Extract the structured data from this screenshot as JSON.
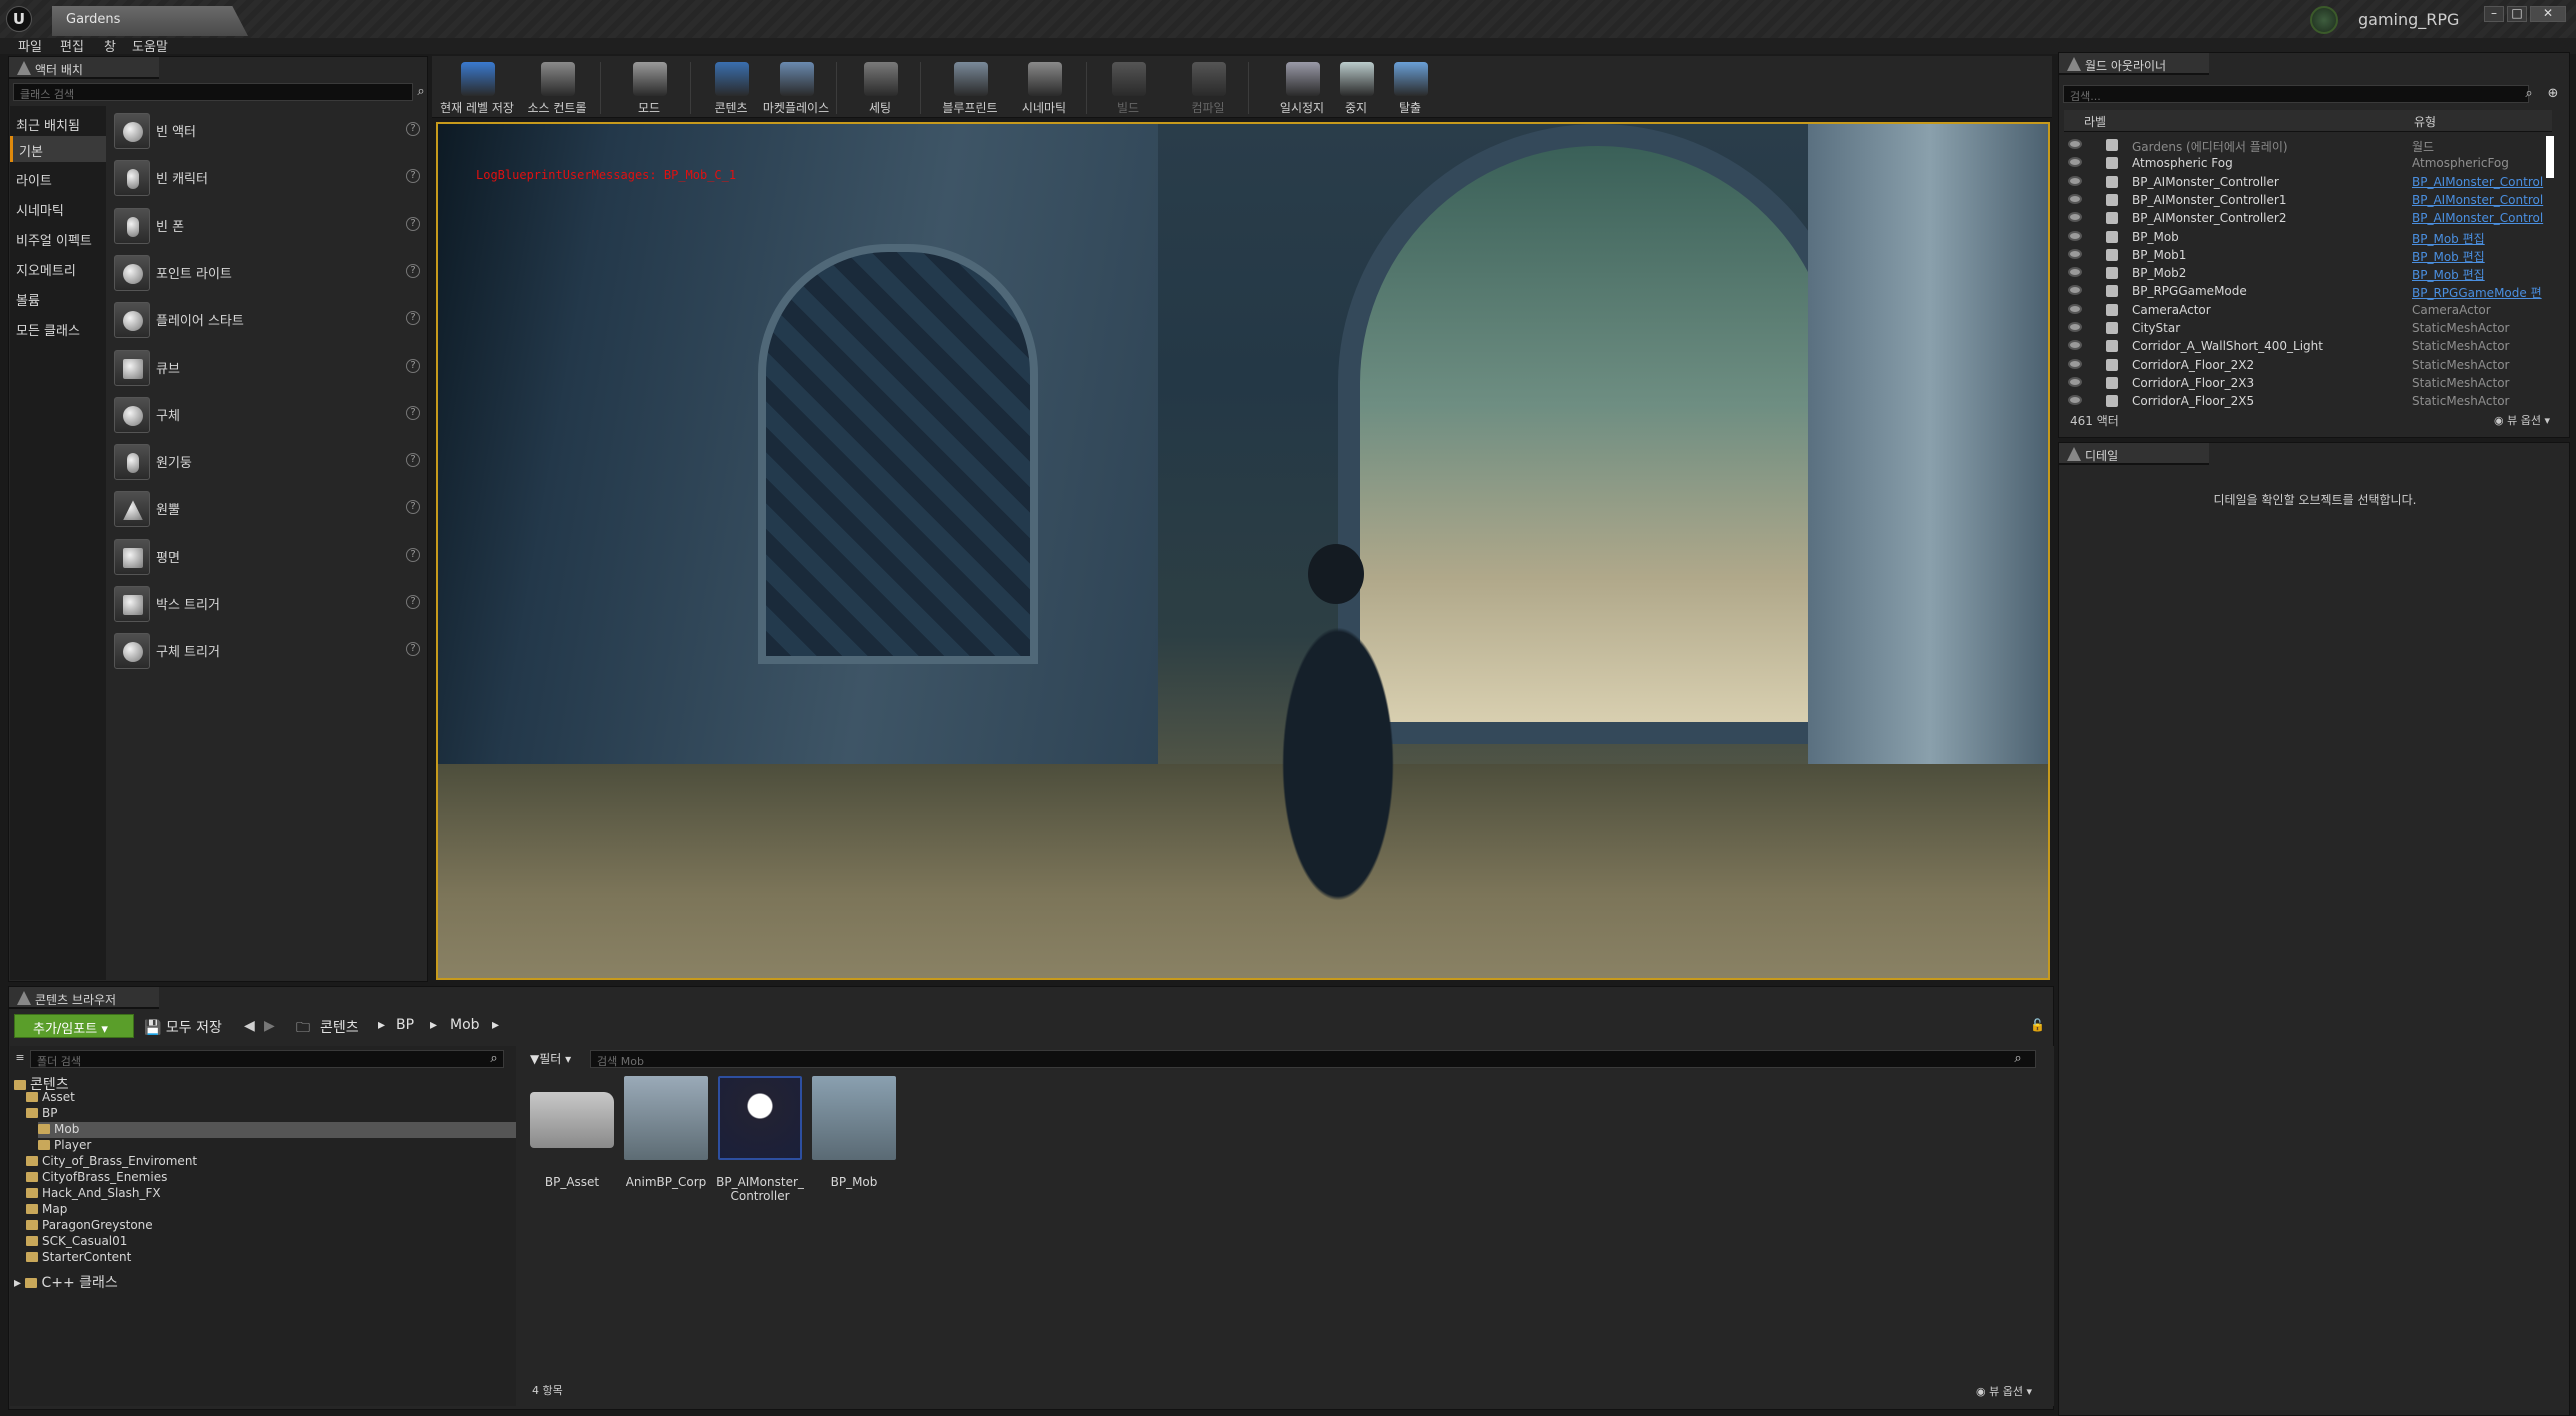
{
  "titlebar": {
    "doc_tab": "Gardens",
    "project_name": "gaming_RPG"
  },
  "menubar": [
    "파일",
    "편집",
    "창",
    "도움말"
  ],
  "place_actors": {
    "tab": "액터 배치",
    "search_placeholder": "클래스 검색",
    "categories": [
      "최근 배치됨",
      "기본",
      "라이트",
      "시네마틱",
      "비주얼 이펙트",
      "지오메트리",
      "볼륨",
      "모든 클래스"
    ],
    "selected_category": "기본",
    "items": [
      "빈 액터",
      "빈 캐릭터",
      "빈 폰",
      "포인트 라이트",
      "플레이어 스타트",
      "큐브",
      "구체",
      "원기둥",
      "원뿔",
      "평면",
      "박스 트리거",
      "구체 트리거"
    ]
  },
  "toolbar": {
    "tools": [
      "현재 레벨 저장",
      "소스 컨트롤",
      "모드",
      "콘텐츠",
      "마켓플레이스",
      "세팅",
      "블루프린트",
      "시네마틱",
      "빌드",
      "컴파일",
      "일시정지",
      "중지",
      "탈출"
    ]
  },
  "viewport": {
    "debug_text": "LogBlueprintUserMessages: BP_Mob_C_1"
  },
  "outliner": {
    "tab": "월드 아웃라이너",
    "search_placeholder": "검색...",
    "col_label": "라벨",
    "col_type": "유형",
    "rows": [
      {
        "name": "Gardens (에디터에서 플레이)",
        "type": "월드",
        "link": false
      },
      {
        "name": "Atmospheric Fog",
        "type": "AtmosphericFog",
        "link": false
      },
      {
        "name": "BP_AIMonster_Controller",
        "type": "BP_AIMonster_Control",
        "link": true
      },
      {
        "name": "BP_AIMonster_Controller1",
        "type": "BP_AIMonster_Control",
        "link": true
      },
      {
        "name": "BP_AIMonster_Controller2",
        "type": "BP_AIMonster_Control",
        "link": true
      },
      {
        "name": "BP_Mob",
        "type": "BP_Mob 편집",
        "link": true
      },
      {
        "name": "BP_Mob1",
        "type": "BP_Mob 편집",
        "link": true
      },
      {
        "name": "BP_Mob2",
        "type": "BP_Mob 편집",
        "link": true
      },
      {
        "name": "BP_RPGGameMode",
        "type": "BP_RPGGameMode 편",
        "link": true
      },
      {
        "name": "CameraActor",
        "type": "CameraActor",
        "link": false
      },
      {
        "name": "CityStar",
        "type": "StaticMeshActor",
        "link": false
      },
      {
        "name": "Corridor_A_WallShort_400_Light",
        "type": "StaticMeshActor",
        "link": false
      },
      {
        "name": "CorridorA_Floor_2X2",
        "type": "StaticMeshActor",
        "link": false
      },
      {
        "name": "CorridorA_Floor_2X3",
        "type": "StaticMeshActor",
        "link": false
      },
      {
        "name": "CorridorA_Floor_2X5",
        "type": "StaticMeshActor",
        "link": false
      }
    ],
    "actor_count": "461 액터",
    "view_options": "뷰 옵션"
  },
  "details": {
    "tab": "디테일",
    "empty_message": "디테일을 확인할 오브젝트를 선택합니다."
  },
  "content_browser": {
    "tab": "콘텐츠 브라우저",
    "add_import": "추가/임포트",
    "save_all": "모두 저장",
    "breadcrumb": [
      "콘텐츠",
      "BP",
      "Mob"
    ],
    "path_search_placeholder": "폴더 검색",
    "filter_label": "필터",
    "asset_search_placeholder": "검색 Mob",
    "tree": [
      {
        "label": "콘텐츠",
        "indent": 0
      },
      {
        "label": "Asset",
        "indent": 1
      },
      {
        "label": "BP",
        "indent": 1
      },
      {
        "label": "Mob",
        "indent": 2,
        "selected": true
      },
      {
        "label": "Player",
        "indent": 2
      },
      {
        "label": "City_of_Brass_Enviroment",
        "indent": 1
      },
      {
        "label": "CityofBrass_Enemies",
        "indent": 1
      },
      {
        "label": "Hack_And_Slash_FX",
        "indent": 1
      },
      {
        "label": "Map",
        "indent": 1
      },
      {
        "label": "ParagonGreystone",
        "indent": 1
      },
      {
        "label": "SCK_Casual01",
        "indent": 1
      },
      {
        "label": "StarterContent",
        "indent": 1
      }
    ],
    "cpp_classes": "C++ 클래스",
    "assets": [
      "BP_Asset",
      "AnimBP_Corp",
      "BP_AIMonster_\nController",
      "BP_Mob"
    ],
    "item_count": "4 항목",
    "view_options": "뷰 옵션"
  }
}
